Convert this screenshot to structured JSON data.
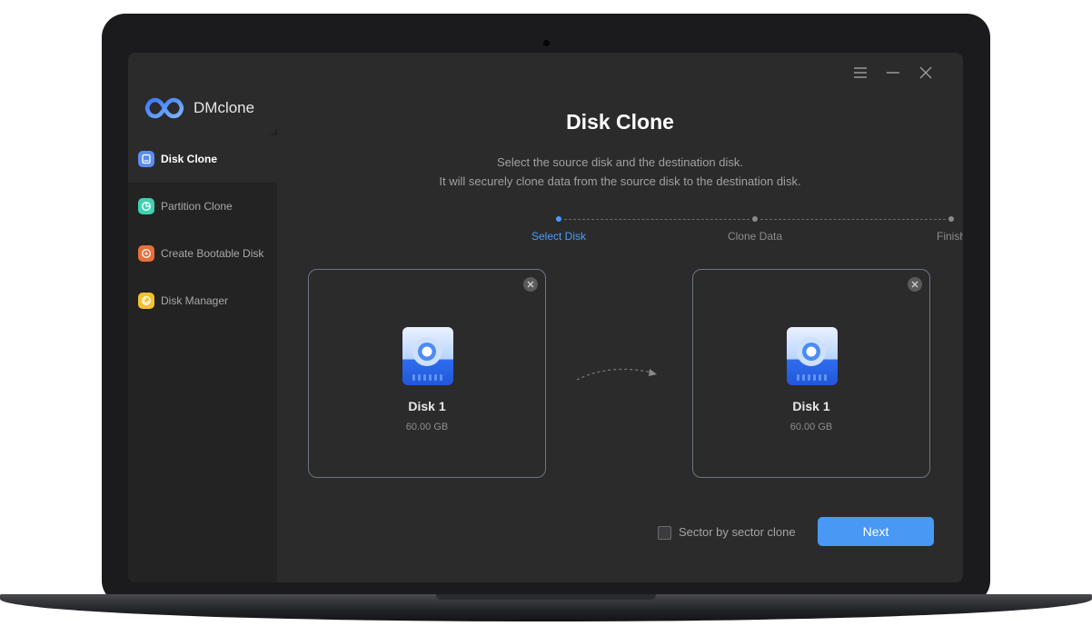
{
  "app": {
    "name": "DMclone"
  },
  "sidebar": {
    "items": [
      {
        "label": "Disk Clone",
        "icon": "disk-icon",
        "color": "#5b8cf0",
        "active": true
      },
      {
        "label": "Partition Clone",
        "icon": "partition-icon",
        "color": "#3fd0b0",
        "active": false
      },
      {
        "label": "Create Bootable Disk",
        "icon": "bootable-disk-icon",
        "color": "#e86f3a",
        "active": false
      },
      {
        "label": "Disk Manager",
        "icon": "disk-manager-icon",
        "color": "#f2c230",
        "active": false
      }
    ]
  },
  "window_controls": [
    "menu-icon",
    "minimize-icon",
    "close-icon"
  ],
  "main": {
    "title": "Disk Clone",
    "subtitle_line1": "Select the source disk and the destination disk.",
    "subtitle_line2": "It will securely clone data from the source disk to the destination disk.",
    "steps": [
      {
        "label": "Select Disk",
        "active": true
      },
      {
        "label": "Clone Data",
        "active": false
      },
      {
        "label": "Finish",
        "active": false
      }
    ],
    "source_disk": {
      "name": "Disk 1",
      "size": "60.00 GB"
    },
    "destination_disk": {
      "name": "Disk 1",
      "size": "60.00 GB"
    },
    "sector_clone_label": "Sector by sector clone",
    "sector_clone_checked": false,
    "next_label": "Next"
  },
  "colors": {
    "accent": "#4898f4",
    "active_step": "#4b9bff"
  }
}
